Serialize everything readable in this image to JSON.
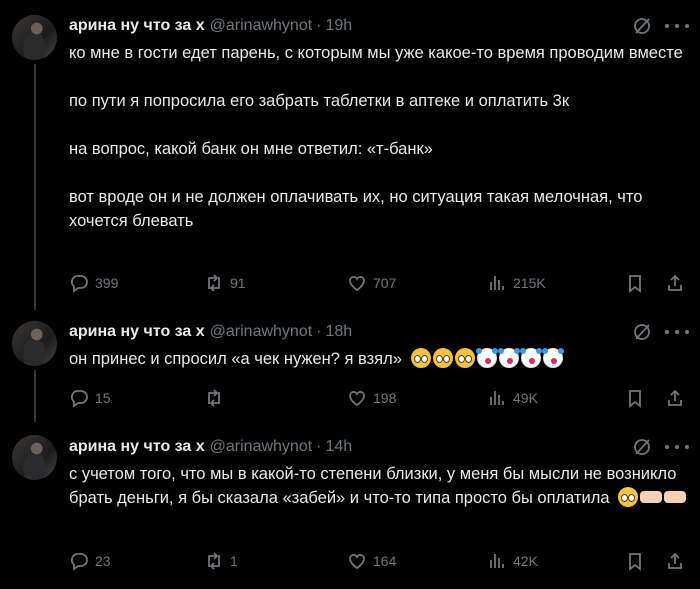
{
  "tweets": [
    {
      "name": "арина ну что за х",
      "handle": "@arinawhynot",
      "time": "19h",
      "paragraphs": [
        "ко мне в гости едет парень, с которым мы уже какое-то время проводим вместе",
        "по пути я попросила его забрать таблетки в аптеке и оплатить 3к",
        "на вопрос, какой банк он мне ответил: «т-банк»",
        "вот вроде он и не должен оплачивать их, но ситуация такая мелочная, что хочется блевать"
      ],
      "replies": "399",
      "reposts": "91",
      "likes": "707",
      "views": "215K"
    },
    {
      "name": "арина ну что за х",
      "handle": "@arinawhynot",
      "time": "18h",
      "text": "он принес и спросил «а чек нужен? я взял»",
      "emojis": [
        "pleading-face",
        "pleading-face",
        "pleading-face",
        "clown-face",
        "clown-face",
        "clown-face",
        "clown-face"
      ],
      "replies": "15",
      "reposts": "",
      "likes": "198",
      "views": "49K"
    },
    {
      "name": "арина ну что за х",
      "handle": "@arinawhynot",
      "time": "14h",
      "text": "с учетом того, что мы в какой-то степени близки, у меня бы мысли не возникло брать деньги, я бы сказала «забей» и что-то типа просто бы оплатила",
      "emojis": [
        "pleading-face",
        "pointing-right",
        "pointing-left"
      ],
      "replies": "23",
      "reposts": "1",
      "likes": "164",
      "views": "42K"
    }
  ],
  "colors": {
    "background": "#000000",
    "text": "#e7e9ea",
    "muted": "#71767b",
    "thread_line": "#333639"
  }
}
